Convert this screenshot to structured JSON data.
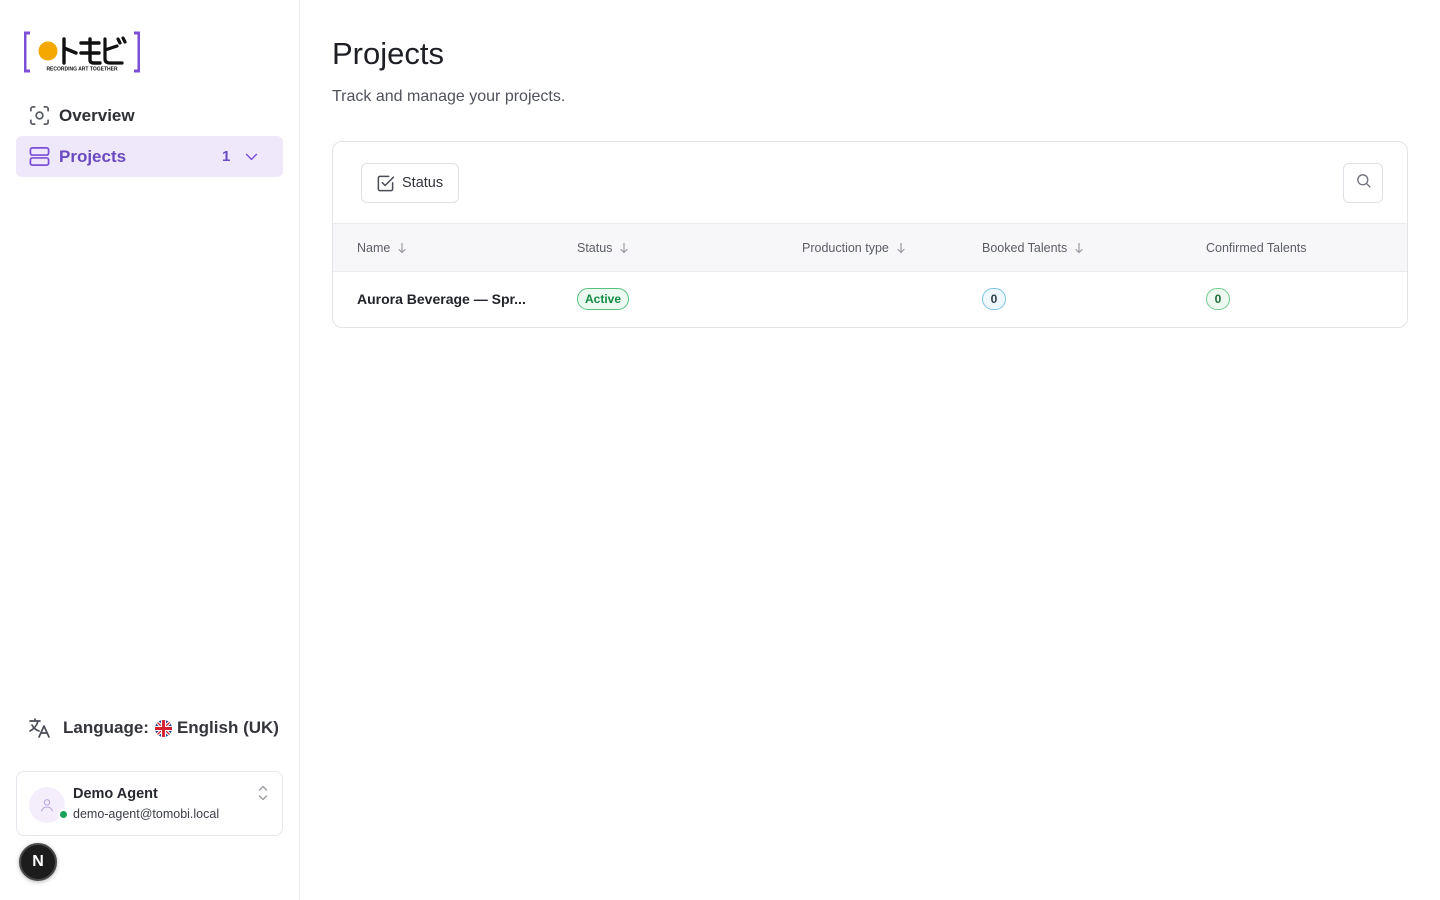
{
  "brand": {
    "logo_text": "トモビ",
    "logo_tagline": "RECORDING ART TOGETHER",
    "accent": "#7b4fd6",
    "dot_color": "#f5a800"
  },
  "sidebar": {
    "items": [
      {
        "label": "Overview",
        "icon": "focus-icon",
        "active": false
      },
      {
        "label": "Projects",
        "icon": "server-icon",
        "active": true,
        "count": "1"
      }
    ],
    "language": {
      "label": "Language:",
      "value": "English (UK)",
      "flag": "uk-flag"
    },
    "user": {
      "name": "Demo Agent",
      "email": "demo-agent@tomobi.local",
      "status": "online"
    },
    "dev_badge": "N"
  },
  "main": {
    "title": "Projects",
    "subtitle": "Track and manage your projects.",
    "toolbar": {
      "status_filter_label": "Status"
    },
    "table": {
      "columns": [
        "Name",
        "Status",
        "Production type",
        "Booked Talents",
        "Confirmed Talents"
      ],
      "rows": [
        {
          "name": "Aurora Beverage — Spr...",
          "status": "Active",
          "production_type": "",
          "booked_talents": "0",
          "confirmed_talents": "0"
        }
      ]
    }
  }
}
